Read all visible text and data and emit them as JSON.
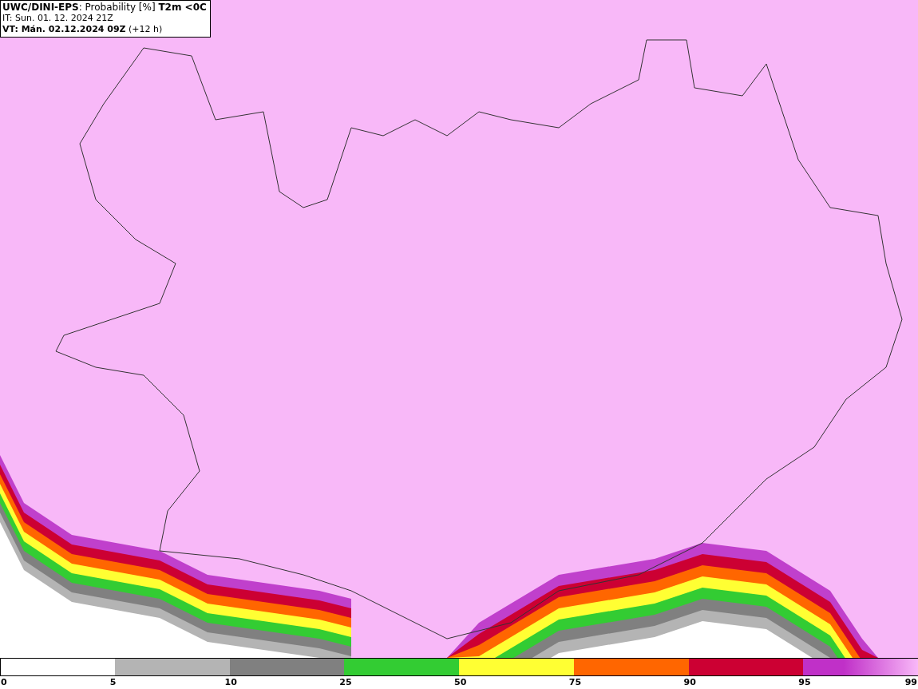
{
  "header": {
    "title": "**UWC/DINI-EPS**: Probability [%] **T2m <0C**",
    "initial_time": "IT: Sun. 01. 12. 2024 21Z",
    "valid_time": "**VT: Mán. 02.12.2024 09Z** (+12 h)"
  },
  "legend": {
    "segments": [
      {
        "color": "#ffffff"
      },
      {
        "color": "#b4b4b4"
      },
      {
        "color": "#808080"
      },
      {
        "color": "#33cc33"
      },
      {
        "color": "#ffff33"
      },
      {
        "color": "#ff6600"
      },
      {
        "color": "#cc0033"
      },
      {
        "color": "#c030c8"
      }
    ],
    "labels": [
      "0",
      "5",
      "10",
      "25",
      "50",
      "75",
      "90",
      "95",
      "99"
    ]
  }
}
